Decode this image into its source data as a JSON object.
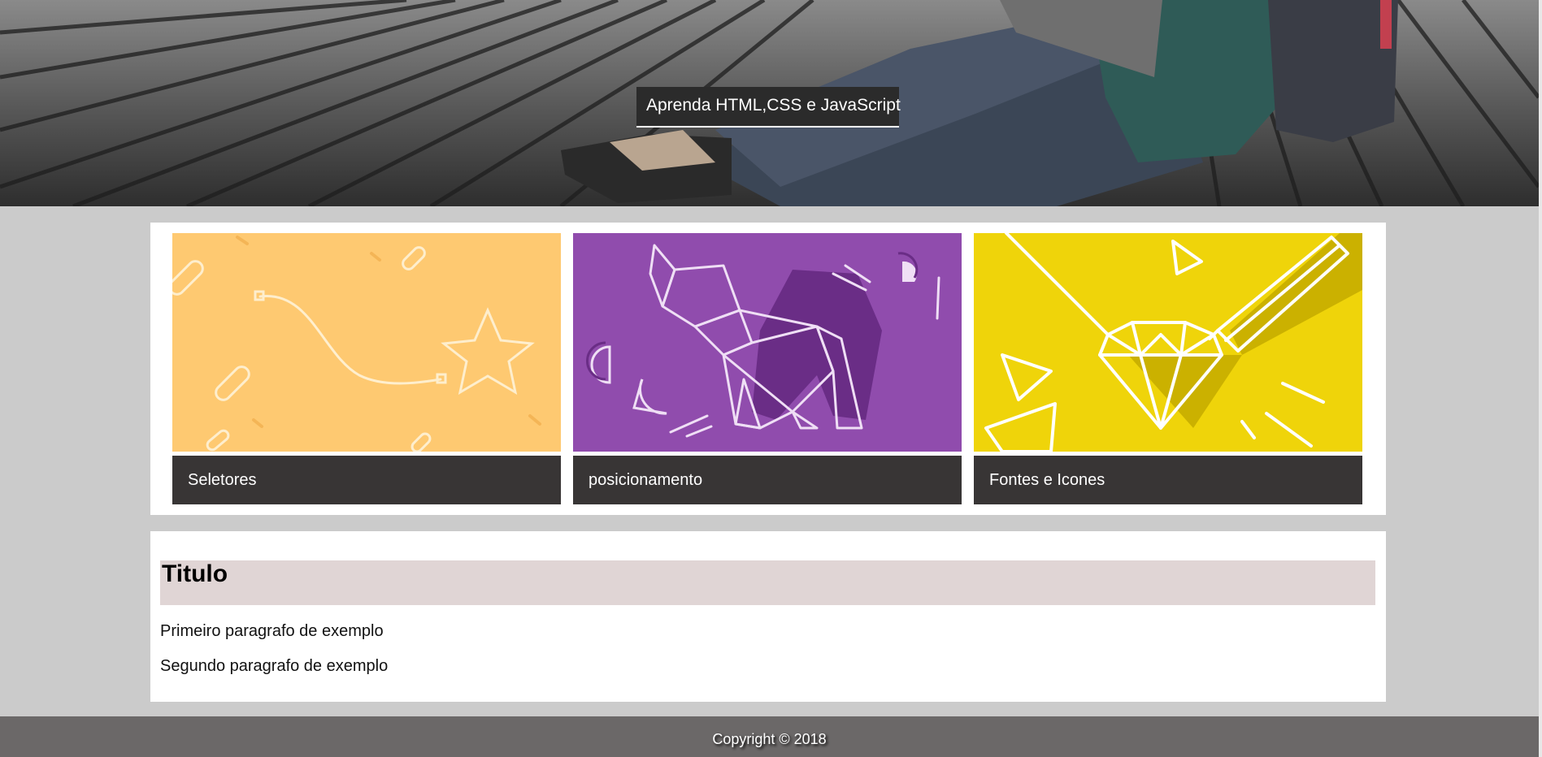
{
  "hero": {
    "title": "Aprenda HTML,CSS e JavaScript"
  },
  "cards": [
    {
      "label": "Seletores",
      "color": "#fec971",
      "icon": "star-trail-illustration"
    },
    {
      "label": "posicionamento",
      "color": "#904cad",
      "icon": "origami-elephant-illustration"
    },
    {
      "label": "Fontes e Icones",
      "color": "#efd40a",
      "icon": "diamond-pencil-illustration"
    }
  ],
  "content": {
    "title": "Titulo",
    "paragraphs": [
      "Primeiro paragrafo de exemplo",
      "Segundo paragrafo de exemplo"
    ]
  },
  "footer": {
    "copyright": "Copyright © 2018"
  },
  "colors": {
    "page_bg": "#cbcbcb",
    "caption_bg": "#383535",
    "title_bg": "#e0d5d5",
    "footer_bg": "#6b6868"
  }
}
